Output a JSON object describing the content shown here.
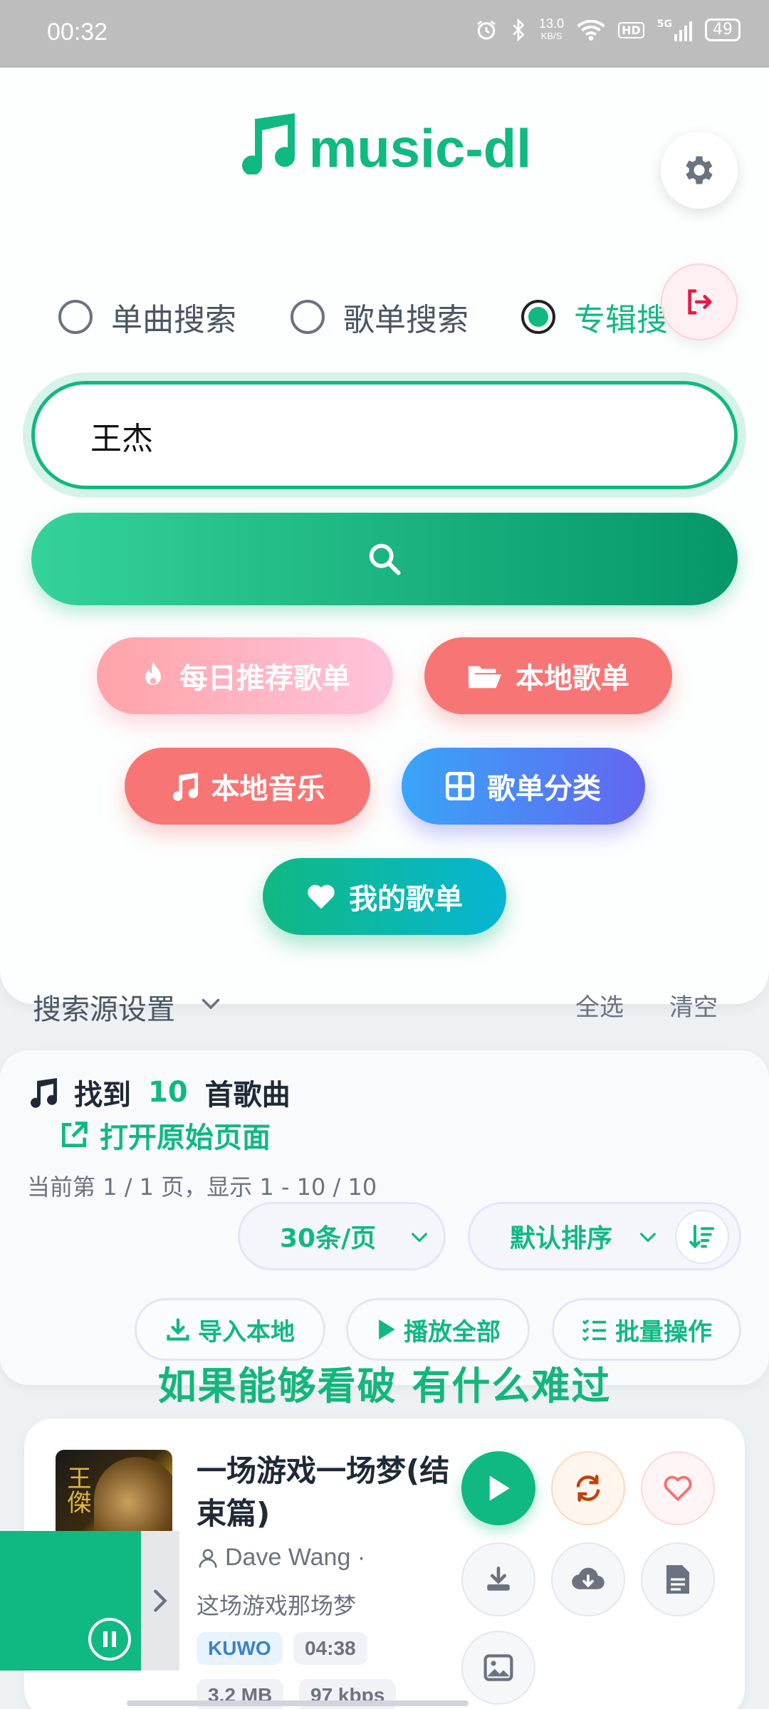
{
  "status_bar": {
    "time": "00:32",
    "speed_value": "13.0",
    "speed_unit": "KB/S",
    "battery": "49",
    "network": "5G",
    "hd_label": "HD"
  },
  "app": {
    "title": "music-dl",
    "accent_color": "#10b981"
  },
  "search_modes": [
    {
      "label": "单曲搜索",
      "checked": false
    },
    {
      "label": "歌单搜索",
      "checked": false
    },
    {
      "label": "专辑搜",
      "checked": true
    }
  ],
  "search": {
    "query": "王杰"
  },
  "quick_actions": {
    "daily": "每日推荐歌单",
    "local_playlist": "本地歌单",
    "local_music": "本地音乐",
    "category": "歌单分类",
    "my_playlist": "我的歌单"
  },
  "source_settings": {
    "label": "搜索源设置",
    "select_all": "全选",
    "clear": "清空"
  },
  "results": {
    "found_prefix": "找到",
    "count": "10",
    "found_suffix": "首歌曲",
    "open_original": "打开原始页面",
    "page_info": "当前第 1 / 1 页，显示 1 - 10 / 10",
    "per_page": "30条/页",
    "sort": "默认排序",
    "import_local": "导入本地",
    "play_all": "播放全部",
    "batch": "批量操作"
  },
  "lyric_overlay": "如果能够看破 有什么难过",
  "song": {
    "title": "一场游戏一场梦(结束篇)",
    "artist": "Dave Wang ·",
    "album": "这场游戏那场梦",
    "source": "KUWO",
    "duration": "04:38",
    "size": "3.2 MB",
    "bitrate": "97 kbps",
    "cover_text": "王傑"
  }
}
